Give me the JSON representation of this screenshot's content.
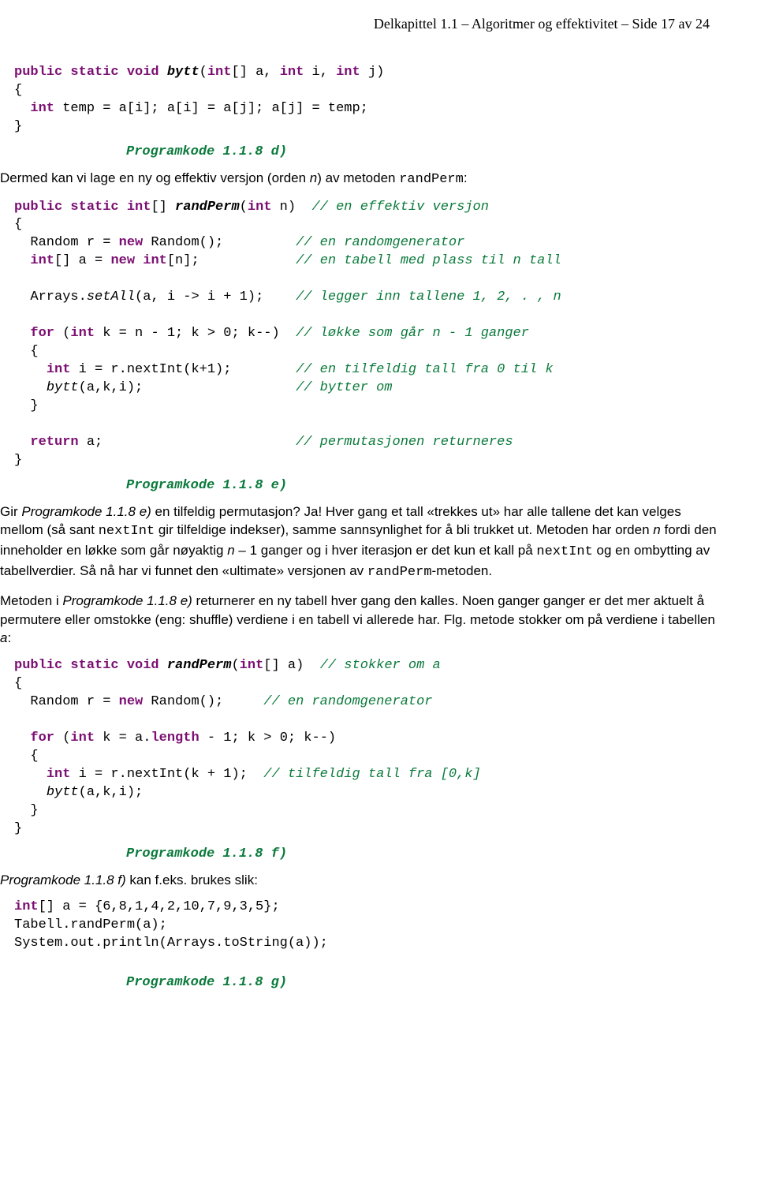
{
  "header": "Delkapittel 1.1  –  Algoritmer og effektivitet  –   Side 17 av 24",
  "code_d": {
    "l1a": "public static void",
    "l1b": "bytt",
    "l1c": "(",
    "l1d": "int",
    "l1e": "[] a, ",
    "l1f": "int",
    "l1g": " i, ",
    "l1h": "int",
    "l1i": " j)",
    "l2": "{",
    "l3a": "int",
    "l3b": " temp = a[i]; a[i] = a[j]; a[j] = temp;",
    "l4": "}",
    "label": "Programkode 1.1.8 d)"
  },
  "para1a": "Dermed kan vi lage en ny og effektiv versjon (orden ",
  "para1b": "n",
  "para1c": ") av metoden ",
  "para1d": "randPerm",
  "para1e": ":",
  "code_e": {
    "l1a": "public static int",
    "l1b": "[] ",
    "l1c": "randPerm",
    "l1d": "(",
    "l1e": "int",
    "l1f": " n)  ",
    "l1g": "// en effektiv versjon",
    "l2": "{",
    "l3a": "  Random r = ",
    "l3b": "new",
    "l3c": " Random();         ",
    "l3d": "// en randomgenerator",
    "l4a": "  ",
    "l4b": "int",
    "l4c": "[] a = ",
    "l4d": "new int",
    "l4e": "[n];            ",
    "l4f": "// en tabell med plass til n tall",
    "l5": "",
    "l6a": "  Arrays.",
    "l6b": "setAll",
    "l6c": "(a, i -> i + 1);    ",
    "l6d": "// legger inn tallene 1, 2, . , n",
    "l7": "",
    "l8a": "  ",
    "l8b": "for",
    "l8c": " (",
    "l8d": "int",
    "l8e": " k = n - 1; k > 0; k--)  ",
    "l8f": "// løkke som går n - 1 ganger",
    "l9": "  {",
    "l10a": "    ",
    "l10b": "int",
    "l10c": " i = r.nextInt(k+1);        ",
    "l10d": "// en tilfeldig tall fra 0 til k",
    "l11a": "    ",
    "l11b": "bytt",
    "l11c": "(a,k,i);                   ",
    "l11d": "// bytter om",
    "l12": "  }",
    "l13": "",
    "l14a": "  ",
    "l14b": "return",
    "l14c": " a;                        ",
    "l14d": "// permutasjonen returneres",
    "l15": "}",
    "label": "Programkode 1.1.8 e)"
  },
  "para2a": "Gir ",
  "para2b": "Programkode 1.1.8 e)",
  "para2c": " en tilfeldig permutasjon? Ja! Hver gang et tall «trekkes ut» har alle tallene det kan velges mellom (så sant ",
  "para2d": "nextInt",
  "para2e": " gir tilfeldige indekser), samme sannsynlighet for å bli trukket ut. Metoden har orden ",
  "para2f": "n",
  "para2g": " fordi den inneholder en løkke som går nøyaktig ",
  "para2h": "n",
  "para2i": " – 1 ganger og i hver iterasjon er det kun et kall på ",
  "para2j": "nextInt",
  "para2k": " og en ombytting av tabellverdier. Så nå har vi funnet den «ultimate» versjonen av ",
  "para2l": "randPerm",
  "para2m": "-metoden.",
  "para3a": "Metoden i ",
  "para3b": "Programkode 1.1.8 e)",
  "para3c": " returnerer en ny tabell hver gang den kalles. Noen ganger ganger er det mer aktuelt å permutere eller omstokke (eng: shuffle) verdiene i en tabell vi allerede har. Flg. metode stokker om på verdiene i tabellen ",
  "para3d": "a",
  "para3e": ":",
  "code_f": {
    "l1a": "public static void",
    "l1b": " ",
    "l1c": "randPerm",
    "l1d": "(",
    "l1e": "int",
    "l1f": "[] a)  ",
    "l1g": "// stokker om a",
    "l2": "{",
    "l3a": "  Random r = ",
    "l3b": "new",
    "l3c": " Random();     ",
    "l3d": "// en randomgenerator",
    "l4": "",
    "l5a": "  ",
    "l5b": "for",
    "l5c": " (",
    "l5d": "int",
    "l5e": " k = a.",
    "l5f": "length",
    "l5g": " - 1; k > 0; k--)",
    "l6": "  {",
    "l7a": "    ",
    "l7b": "int",
    "l7c": " i = r.nextInt(k + 1);  ",
    "l7d": "// tilfeldig tall fra [0,k]",
    "l8a": "    ",
    "l8b": "bytt",
    "l8c": "(a,k,i);",
    "l9": "  }",
    "l10": "}",
    "label": "Programkode 1.1.8 f)"
  },
  "para4a": "Programkode 1.1.8 f)",
  "para4b": " kan f.eks. brukes slik:",
  "code_g": {
    "l1a": "int",
    "l1b": "[] a = {6,8,1,4,2,10,7,9,3,5};",
    "l2": "Tabell.randPerm(a);",
    "l3": "System.out.println(Arrays.toString(a));",
    "label": "Programkode 1.1.8 g)"
  }
}
